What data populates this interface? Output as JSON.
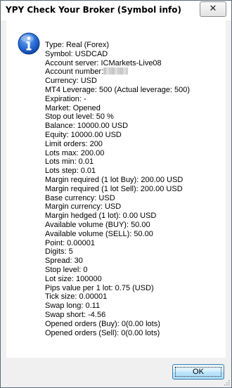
{
  "window": {
    "title": "YPY Check Your Broker (Symbol info)",
    "close_glyph": "✕"
  },
  "icons": {
    "info": "info-icon",
    "close": "close-icon",
    "grip": "resize-grip-icon"
  },
  "info": {
    "lines": [
      "Type: Real (Forex)",
      "Symbol: USDCAD",
      "Account server: ICMarkets-Live08",
      "Account number:",
      "Currency: USD",
      "MT4 Leverage: 500 (Actual leverage: 500)",
      "Expiration: -",
      "Market: Opened",
      "Stop out level: 50 %",
      "Balance: 10000.00 USD",
      "Equity: 10000.00 USD",
      "Limit orders: 200",
      "Lots max: 200.00",
      "Lots min: 0.01",
      "Lots step: 0.01",
      "Margin required (1 lot Buy): 200.00 USD",
      "Margin required (1 lot Sell): 200.00 USD",
      "Base currency: USD",
      "Margin currency: USD",
      "Margin hedged (1 lot): 0.00 USD",
      "Available volume (BUY): 50.00",
      "Available volume (SELL): 50.00",
      "Point: 0.00001",
      "Digits: 5",
      "Spread: 30",
      "Stop level: 0",
      "Lot size: 100000",
      "Pips value per 1 lot: 0.75 (USD)",
      "Tick size: 0.00001",
      "Swap long: 0.11",
      "Swap short: -4.56",
      "Opened orders (Buy): 0(0.00 lots)",
      "Opened orders (Sell): 0(0.00 lots)"
    ]
  },
  "buttons": {
    "ok": "OK"
  }
}
